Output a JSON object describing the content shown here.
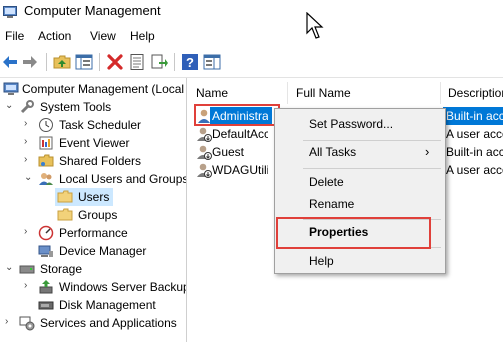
{
  "window": {
    "title": "Computer Management"
  },
  "menu": {
    "file": "File",
    "action": "Action",
    "view": "View",
    "help": "Help"
  },
  "toolbar": {
    "icons": [
      "back-arrow-icon",
      "forward-arrow-icon",
      "up-folder-icon",
      "show-hide-tree-icon",
      "delete-icon",
      "properties-icon",
      "export-list-icon",
      "help-icon",
      "show-action-pane-icon"
    ]
  },
  "tree": {
    "root": "Computer Management (Local",
    "system_tools": "System Tools",
    "task_scheduler": "Task Scheduler",
    "event_viewer": "Event Viewer",
    "shared_folders": "Shared Folders",
    "local_users_groups": "Local Users and Groups",
    "users": "Users",
    "groups": "Groups",
    "performance": "Performance",
    "device_manager": "Device Manager",
    "storage": "Storage",
    "windows_server_backup": "Windows Server Backup",
    "disk_management": "Disk Management",
    "services_apps": "Services and Applications"
  },
  "list": {
    "columns": {
      "name": "Name",
      "full_name": "Full Name",
      "description": "Description"
    },
    "rows": [
      {
        "name": "Administrat",
        "full_name": "",
        "description": "Built-in acc"
      },
      {
        "name": "DefaultAcco",
        "full_name": "",
        "description": "A user acco"
      },
      {
        "name": "Guest",
        "full_name": "",
        "description": "Built-in acc"
      },
      {
        "name": "WDAGUtility",
        "full_name": "",
        "description": "A user acco"
      }
    ]
  },
  "context_menu": {
    "set_password": "Set Password...",
    "all_tasks": "All Tasks",
    "all_tasks_arrow": "›",
    "delete": "Delete",
    "rename": "Rename",
    "properties": "Properties",
    "help": "Help"
  },
  "colors": {
    "selection": "#0078d7",
    "tree_selection": "#cce8ff",
    "highlight_box": "#e0403a"
  }
}
